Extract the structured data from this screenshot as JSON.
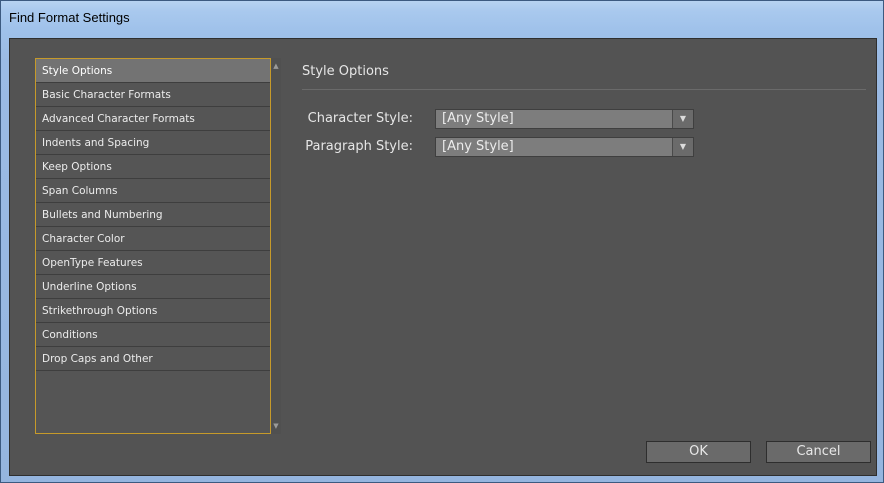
{
  "window": {
    "title": "Find Format Settings"
  },
  "list": {
    "items": [
      {
        "label": "Style Options",
        "selected": true
      },
      {
        "label": "Basic Character Formats",
        "selected": false
      },
      {
        "label": "Advanced Character Formats",
        "selected": false
      },
      {
        "label": "Indents and Spacing",
        "selected": false
      },
      {
        "label": "Keep Options",
        "selected": false
      },
      {
        "label": "Span Columns",
        "selected": false
      },
      {
        "label": "Bullets and Numbering",
        "selected": false
      },
      {
        "label": "Character Color",
        "selected": false
      },
      {
        "label": "OpenType Features",
        "selected": false
      },
      {
        "label": "Underline Options",
        "selected": false
      },
      {
        "label": "Strikethrough Options",
        "selected": false
      },
      {
        "label": "Conditions",
        "selected": false
      },
      {
        "label": "Drop Caps and Other",
        "selected": false
      }
    ]
  },
  "section": {
    "title": "Style Options",
    "character_style_label": "Character Style:",
    "character_style_value": "[Any Style]",
    "paragraph_style_label": "Paragraph Style:",
    "paragraph_style_value": "[Any Style]"
  },
  "buttons": {
    "ok": "OK",
    "cancel": "Cancel"
  },
  "colors": {
    "panel_bg": "#535353",
    "list_border": "#c69a2a",
    "selected_item": "#737373",
    "dropdown_bg": "#7d7d7d"
  },
  "icons": {
    "dropdown": "chevron-down-icon",
    "scroll_up": "scroll-up-icon",
    "scroll_down": "scroll-down-icon"
  }
}
